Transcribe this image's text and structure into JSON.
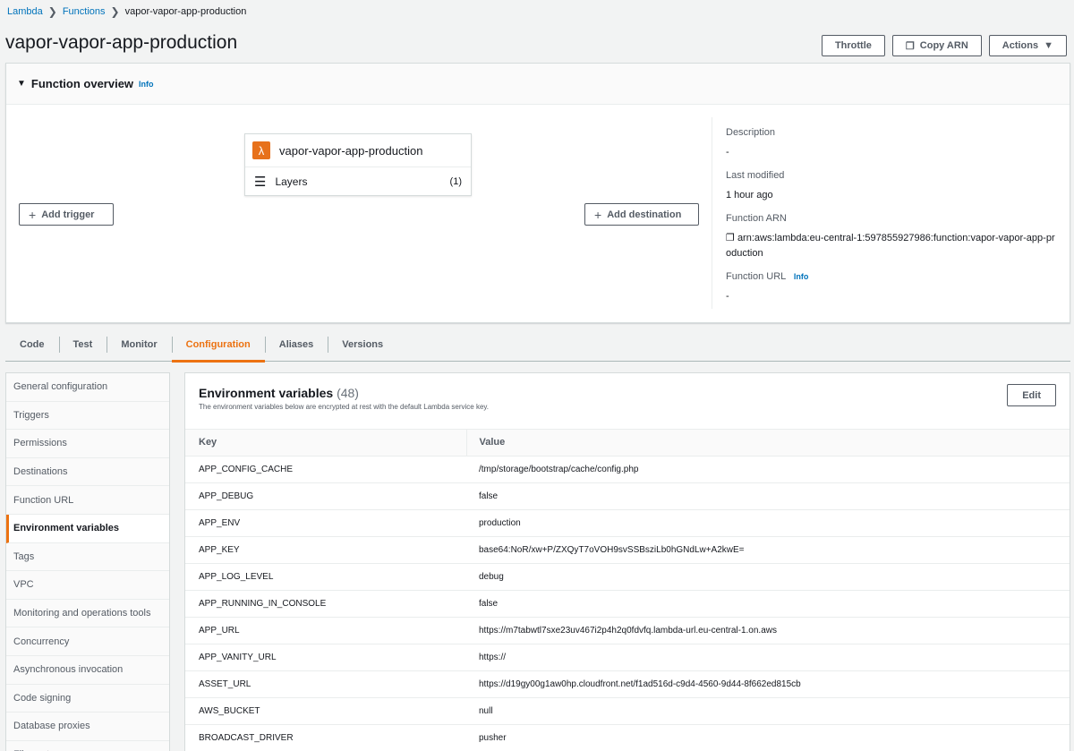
{
  "breadcrumb": {
    "items": [
      "Lambda",
      "Functions"
    ],
    "current": "vapor-vapor-app-production"
  },
  "page": {
    "title": "vapor-vapor-app-production"
  },
  "actions": {
    "throttle": "Throttle",
    "copy_arn": "Copy ARN",
    "actions": "Actions"
  },
  "overview": {
    "title": "Function overview",
    "info": "Info",
    "function_name": "vapor-vapor-app-production",
    "layers_label": "Layers",
    "layers_count": "(1)",
    "add_trigger": "Add trigger",
    "add_destination": "Add destination",
    "description_label": "Description",
    "description_value": "-",
    "last_modified_label": "Last modified",
    "last_modified_value": "1 hour ago",
    "arn_label": "Function ARN",
    "arn_value_1": "arn:aws:lambda:eu-central-1:597855927986:function:vapor-vapor-app-pr",
    "arn_value_2": "oduction",
    "url_label": "Function URL",
    "url_info": "Info",
    "url_value": "-"
  },
  "tabs": [
    "Code",
    "Test",
    "Monitor",
    "Configuration",
    "Aliases",
    "Versions"
  ],
  "active_tab": "Configuration",
  "sidenav": [
    "General configuration",
    "Triggers",
    "Permissions",
    "Destinations",
    "Function URL",
    "Environment variables",
    "Tags",
    "VPC",
    "Monitoring and operations tools",
    "Concurrency",
    "Asynchronous invocation",
    "Code signing",
    "Database proxies",
    "File systems"
  ],
  "env": {
    "title": "Environment variables",
    "count": "(48)",
    "description": "The environment variables below are encrypted at rest with the default Lambda service key.",
    "edit": "Edit",
    "col_key": "Key",
    "col_value": "Value",
    "rows": [
      {
        "key": "APP_CONFIG_CACHE",
        "value": "/tmp/storage/bootstrap/cache/config.php"
      },
      {
        "key": "APP_DEBUG",
        "value": "false"
      },
      {
        "key": "APP_ENV",
        "value": "production"
      },
      {
        "key": "APP_KEY",
        "value": "base64:NoR/xw+P/ZXQyT7oVOH9svSSBsziLb0hGNdLw+A2kwE="
      },
      {
        "key": "APP_LOG_LEVEL",
        "value": "debug"
      },
      {
        "key": "APP_RUNNING_IN_CONSOLE",
        "value": "false"
      },
      {
        "key": "APP_URL",
        "value": "https://m7tabwtl7sxe23uv467i2p4h2q0fdvfq.lambda-url.eu-central-1.on.aws"
      },
      {
        "key": "APP_VANITY_URL",
        "value": "https://"
      },
      {
        "key": "ASSET_URL",
        "value": "https://d19gy00g1aw0hp.cloudfront.net/f1ad516d-c9d4-4560-9d44-8f662ed815cb"
      },
      {
        "key": "AWS_BUCKET",
        "value": "null"
      },
      {
        "key": "BROADCAST_DRIVER",
        "value": "pusher"
      }
    ]
  },
  "colors": {
    "accent": "#ec7211",
    "link": "#0073bb",
    "lambda": "#e7711b"
  }
}
